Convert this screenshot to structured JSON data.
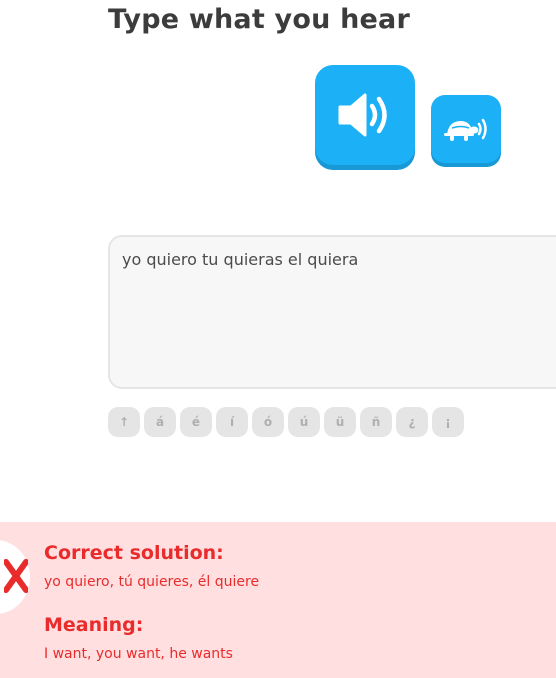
{
  "challenge": {
    "title": "Type what you hear",
    "audio_icon": "speaker-icon",
    "slow_audio_icon": "turtle-icon"
  },
  "answer": {
    "value": "yo quiero tu quieras el quiera",
    "placeholder": ""
  },
  "special_keys": [
    "↑",
    "á",
    "é",
    "í",
    "ó",
    "ú",
    "ü",
    "ñ",
    "¿",
    "¡"
  ],
  "feedback": {
    "status": "incorrect",
    "correct_heading": "Correct solution:",
    "correct_text": "yo quiero, tú quieres, él quiere",
    "meaning_heading": "Meaning:",
    "meaning_text": "I want, you want, he wants"
  },
  "colors": {
    "primary": "#1cb0f6",
    "error": "#ea2b2b",
    "error_bg": "#ffdfe0"
  }
}
